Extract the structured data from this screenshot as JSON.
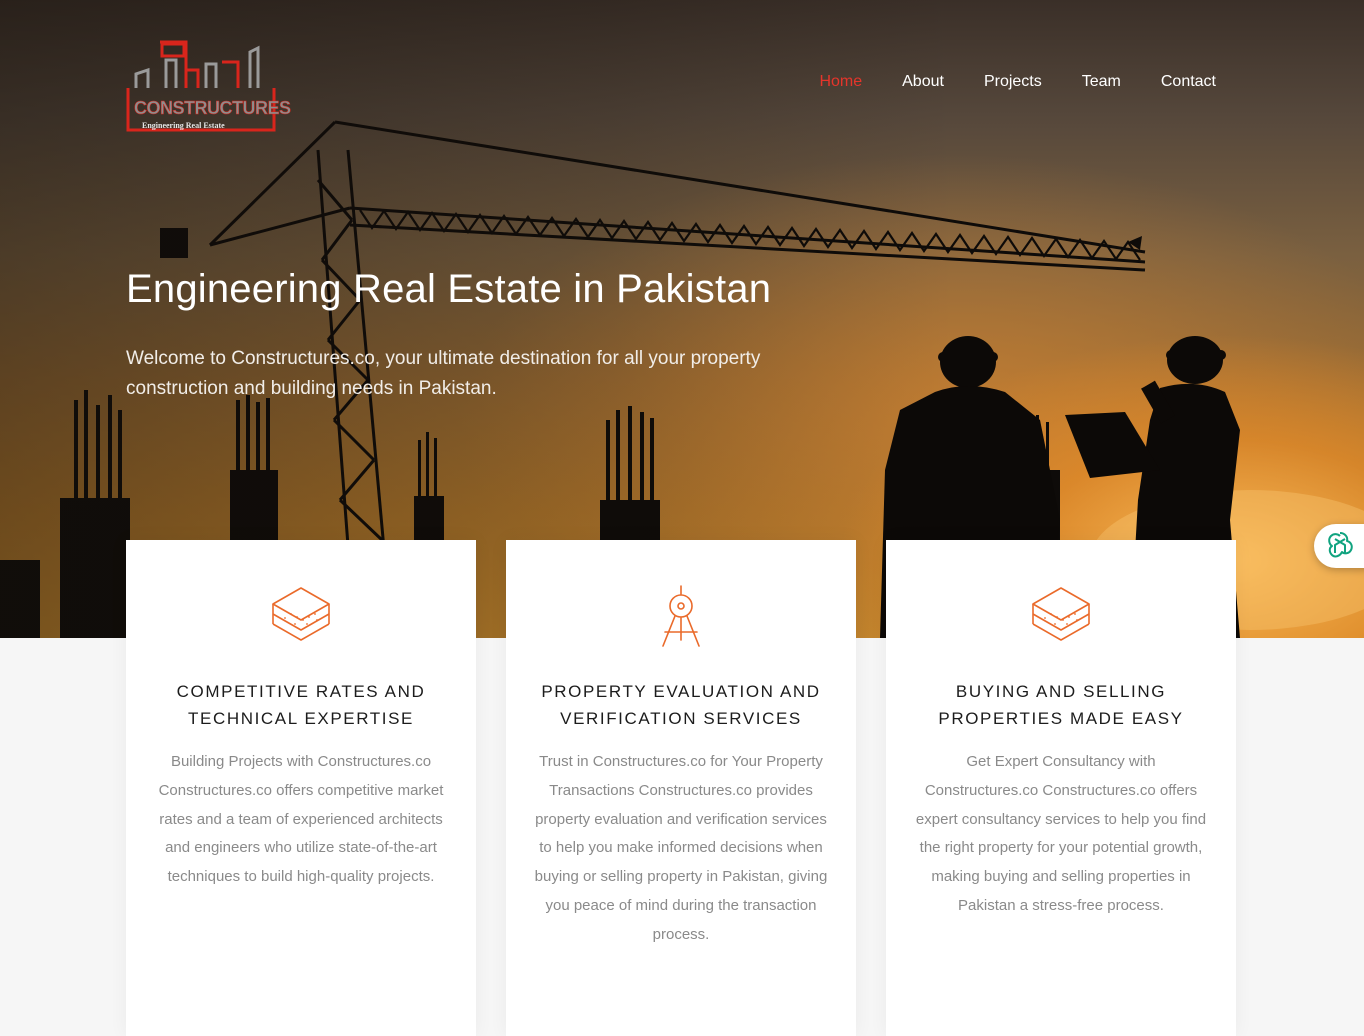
{
  "brand": {
    "name": "CONSTRUCTURES",
    "tagline": "Engineering Real Estate",
    "colors": {
      "red": "#d9251c",
      "accent": "#e5352b",
      "icon_orange": "#ea6a2a"
    }
  },
  "nav": {
    "items": [
      {
        "label": "Home",
        "active": true
      },
      {
        "label": "About",
        "active": false
      },
      {
        "label": "Projects",
        "active": false
      },
      {
        "label": "Team",
        "active": false
      },
      {
        "label": "Contact",
        "active": false
      }
    ]
  },
  "hero": {
    "title": "Engineering Real Estate in Pakistan",
    "subtitle": "Welcome to Constructures.co, your ultimate destination for all your property construction and building needs in Pakistan."
  },
  "cards": [
    {
      "icon": "layers-icon",
      "title_line1": "COMPETITIVE RATES AND",
      "title_line2": "TECHNICAL EXPERTISE",
      "body": "Building Projects with Constructures.co Constructures.co offers competitive market rates and a team of experienced architects and engineers who utilize state-of-the-art techniques to build high-quality projects."
    },
    {
      "icon": "compass-icon",
      "title_line1": "PROPERTY EVALUATION AND",
      "title_line2": "VERIFICATION SERVICES",
      "body": "Trust in Constructures.co for Your Property Transactions Constructures.co provides property evaluation and verification services to help you make informed decisions when buying or selling property in Pakistan, giving you peace of mind during the transaction process."
    },
    {
      "icon": "layers-icon",
      "title_line1": "BUYING AND SELLING",
      "title_line2": "PROPERTIES MADE EASY",
      "body": "Get Expert Consultancy with Constructures.co Constructures.co offers expert consultancy services to help you find the right property for your potential growth, making buying and selling properties in Pakistan a stress-free process."
    }
  ],
  "widget": {
    "icon": "ai-assistant-icon",
    "color": "#10a37f"
  }
}
